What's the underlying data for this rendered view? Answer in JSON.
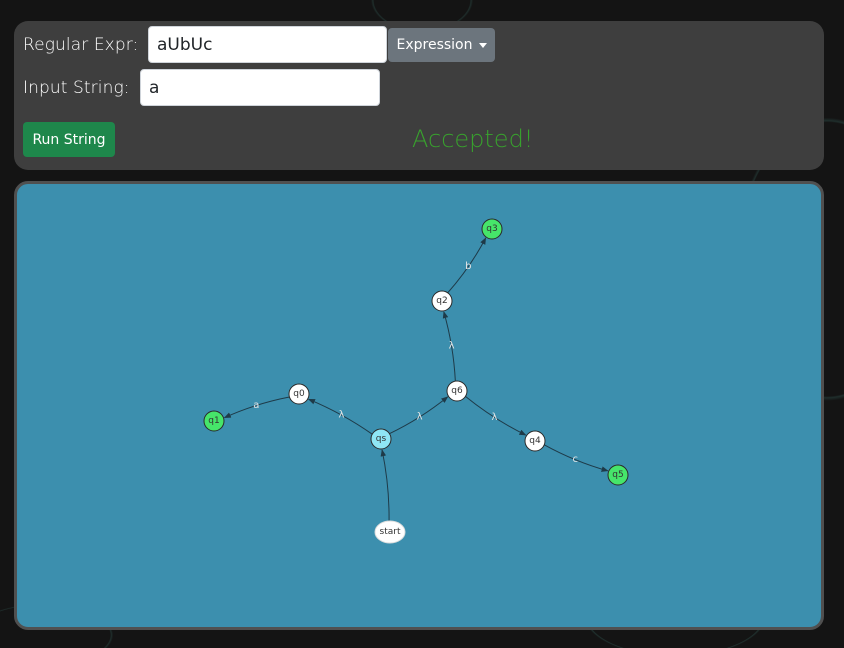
{
  "form": {
    "regex_label": "Regular Expr:",
    "regex_value": "aUbUc",
    "dropdown_label": "Expression",
    "input_label": "Input String:",
    "input_value": "a",
    "run_label": "Run String",
    "status_text": "Accepted!"
  },
  "colors": {
    "accepting_node": "#46e56a",
    "current_node": "#8fe6f5",
    "normal_node": "#ffffff",
    "status": "#38a32d",
    "run_button": "#1e874b",
    "graph_background": "#3c8fae"
  },
  "graph": {
    "nodes": [
      {
        "id": "start",
        "label": "start",
        "kind": "start"
      },
      {
        "id": "qs",
        "label": "qs",
        "kind": "current"
      },
      {
        "id": "q0",
        "label": "q0",
        "kind": "normal"
      },
      {
        "id": "q1",
        "label": "q1",
        "kind": "accepting"
      },
      {
        "id": "q6",
        "label": "q6",
        "kind": "normal"
      },
      {
        "id": "q2",
        "label": "q2",
        "kind": "normal"
      },
      {
        "id": "q3",
        "label": "q3",
        "kind": "accepting"
      },
      {
        "id": "q4",
        "label": "q4",
        "kind": "normal"
      },
      {
        "id": "q5",
        "label": "q5",
        "kind": "accepting"
      }
    ],
    "edges": [
      {
        "from": "start",
        "to": "qs",
        "label": ""
      },
      {
        "from": "qs",
        "to": "q0",
        "label": "λ"
      },
      {
        "from": "q0",
        "to": "q1",
        "label": "a"
      },
      {
        "from": "qs",
        "to": "q6",
        "label": "λ"
      },
      {
        "from": "q6",
        "to": "q2",
        "label": "λ"
      },
      {
        "from": "q2",
        "to": "q3",
        "label": "b"
      },
      {
        "from": "q6",
        "to": "q4",
        "label": "λ"
      },
      {
        "from": "q4",
        "to": "q5",
        "label": "c"
      }
    ]
  }
}
